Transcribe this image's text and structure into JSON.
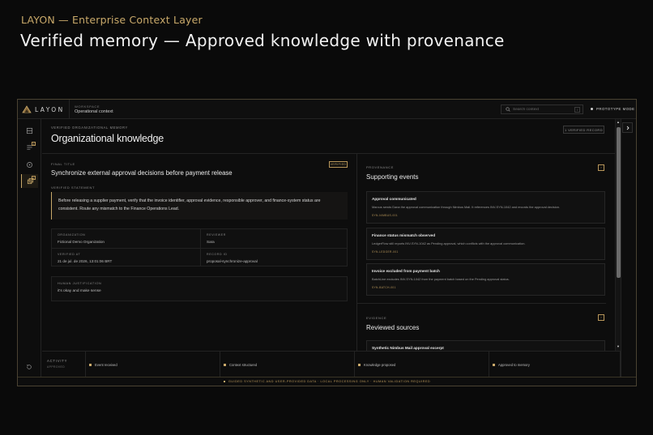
{
  "slide": {
    "kicker": "LAYON — Enterprise Context Layer",
    "title": "Verified memory — Approved knowledge with provenance"
  },
  "topbar": {
    "logo_text": "LAYON",
    "workspace_label": "WORKSPACE",
    "workspace_name": "Operational context",
    "search_placeholder": "Search context",
    "search_shortcut": "/",
    "mode_label": "PROTOTYPE MODE"
  },
  "rail": {
    "items": [
      {
        "icon": "inbox-icon",
        "badge": ""
      },
      {
        "icon": "list-icon",
        "badge": "4"
      },
      {
        "icon": "target-icon",
        "badge": ""
      },
      {
        "icon": "layers-icon",
        "badge": "1"
      }
    ],
    "bottom_icon": "history-icon"
  },
  "knowledge": {
    "kicker": "VERIFIED ORGANIZATIONAL MEMORY",
    "title": "Organizational knowledge",
    "record_button": "1 VERIFIED RECORD",
    "final_title_label": "FINAL TITLE",
    "final_title": "Synchronize external approval decisions before payment release",
    "verified_tag": "VERIFIED",
    "statement_label": "VERIFIED STATEMENT",
    "statement": "Before releasing a supplier payment, verify that the invoice identifier, approval evidence, responsible approver, and finance-system status are consistent. Route any mismatch to the Finance Operations Lead.",
    "meta": [
      {
        "label": "ORGANIZATION",
        "value": "Fictional Demo Organization"
      },
      {
        "label": "REVIEWER",
        "value": "Sara"
      },
      {
        "label": "VERIFIED AT",
        "value": "21 de jul. de 2026, 13:01:06 BRT"
      },
      {
        "label": "RECORD ID",
        "value": "proposal-synchronize-approval"
      }
    ],
    "justification_label": "HUMAN JUSTIFICATION",
    "justification": "it's okay and make sense"
  },
  "provenance": {
    "label": "PROVENANCE",
    "title": "Supporting events",
    "events": [
      {
        "title": "Approval communicated",
        "desc": "Marcus sends Dana the approval communication through Nimbus Mail. It references INV-SYN-1042 and records the approval decision.",
        "id": "SYN-NIMBUS-001"
      },
      {
        "title": "Finance status mismatch observed",
        "desc": "LedgerFlow still reports INV-SYN-1042 as Pending approval, which conflicts with the approval communication.",
        "id": "SYN-LEDGER-001"
      },
      {
        "title": "Invoice excluded from payment batch",
        "desc": "BatchLine excludes INV-SYN-1042 from the payment batch based on the Pending approval status.",
        "id": "SYN-BATCH-001"
      }
    ]
  },
  "evidence": {
    "label": "EVIDENCE",
    "title": "Reviewed sources",
    "sources": [
      {
        "title": "Synthetic Nimbus Mail approval excerpt"
      }
    ]
  },
  "activity": {
    "label": "ACTIVITY",
    "sub": "APPROVED",
    "steps": [
      "Event received",
      "Context structured",
      "Knowledge proposed",
      "Approved to memory"
    ]
  },
  "footer": {
    "text": "GUIDED SYNTHETIC AND USER-PROVIDED DATA · LOCAL PROCESSING ONLY · HUMAN VALIDATION REQUIRED"
  },
  "colors": {
    "accent": "#c9a96a",
    "background": "#0a0a0a",
    "panel": "#0d0d0d"
  }
}
